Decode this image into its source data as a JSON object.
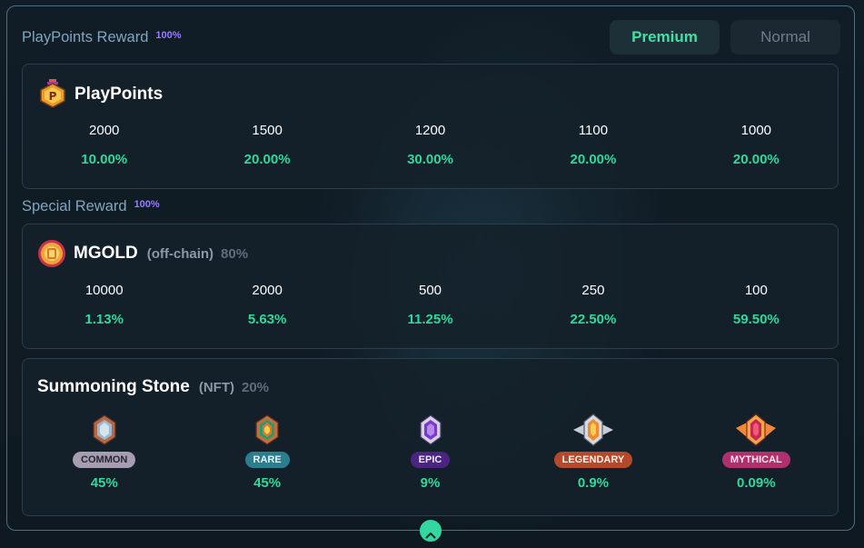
{
  "playpoints_reward": {
    "title": "PlayPoints Reward",
    "percent": "100%",
    "tabs": {
      "premium": "Premium",
      "normal": "Normal"
    },
    "card": {
      "title": "PlayPoints",
      "icon": "playpoints-medal-icon",
      "amounts": [
        "2000",
        "1500",
        "1200",
        "1100",
        "1000"
      ],
      "rates": [
        "10.00%",
        "20.00%",
        "30.00%",
        "20.00%",
        "20.00%"
      ]
    }
  },
  "special_reward": {
    "title": "Special Reward",
    "percent": "100%",
    "mgold": {
      "title": "MGOLD",
      "subtitle": "(off-chain)",
      "share": "80%",
      "icon": "mgold-coin-icon",
      "amounts": [
        "10000",
        "2000",
        "500",
        "250",
        "100"
      ],
      "rates": [
        "1.13%",
        "5.63%",
        "11.25%",
        "22.50%",
        "59.50%"
      ]
    },
    "summoning_stone": {
      "title": "Summoning Stone",
      "subtitle": "(NFT)",
      "share": "20%",
      "tiers": [
        {
          "label": "COMMON",
          "rate": "45%",
          "icon": "common-stone-icon",
          "badge_color": "#a59db2"
        },
        {
          "label": "RARE",
          "rate": "45%",
          "icon": "rare-stone-icon",
          "badge_color": "#2a7e8e"
        },
        {
          "label": "EPIC",
          "rate": "9%",
          "icon": "epic-stone-icon",
          "badge_color": "#5a2d8c"
        },
        {
          "label": "LEGENDARY",
          "rate": "0.9%",
          "icon": "legendary-stone-icon",
          "badge_color": "#b4492b"
        },
        {
          "label": "MYTHICAL",
          "rate": "0.09%",
          "icon": "mythical-stone-icon",
          "badge_color": "#b0306e"
        }
      ]
    }
  },
  "colors": {
    "accent": "#2fd99a",
    "percent_badge": "#9b7bff",
    "section_title": "#7fa6bf"
  },
  "collapse_icon": "chevron-up-icon"
}
